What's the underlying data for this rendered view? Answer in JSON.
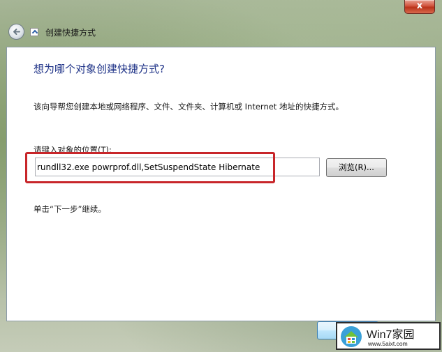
{
  "window": {
    "close_label": "x",
    "nav_title": "创建快捷方式"
  },
  "wizard": {
    "heading": "想为哪个对象创建快捷方式?",
    "description": "该向导帮您创建本地或网络程序、文件、文件夹、计算机或 Internet 地址的快捷方式。",
    "input_label": "请键入对象的位置(T):",
    "input_value": "rundll32.exe powrprof.dll,SetSuspendState Hibernate",
    "browse_label": "浏览(R)...",
    "hint": "单击“下一步”继续。"
  },
  "watermark": {
    "brand": "Win7家园",
    "url": "www.5aixt.com"
  },
  "colors": {
    "heading": "#1e3287",
    "highlight": "#c8262a",
    "close_button": "#c8432a"
  },
  "icons": {
    "back": "back-arrow-icon",
    "wizard": "shortcut-wizard-icon",
    "watermark_logo": "house-logo-icon"
  }
}
